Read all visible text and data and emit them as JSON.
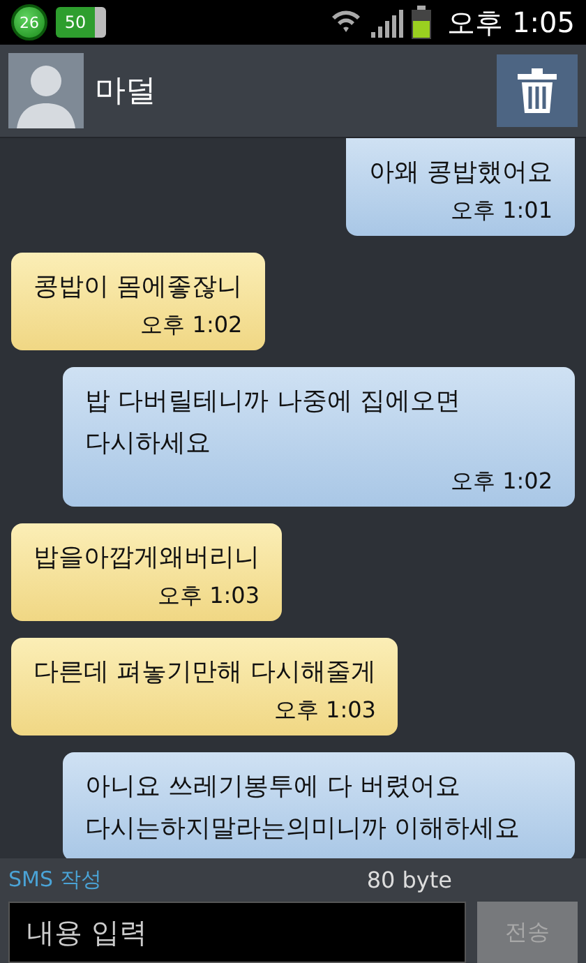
{
  "status_bar": {
    "temperature": "26",
    "battery_widget": "50",
    "time": "오후 1:05"
  },
  "header": {
    "contact_name": "마덜"
  },
  "messages": [
    {
      "kind": "outgoing",
      "text": "아왜 콩밥했어요",
      "time": "오후 1:01"
    },
    {
      "kind": "incoming",
      "text": "콩밥이 몸에좋잖니",
      "time": "오후 1:02"
    },
    {
      "kind": "outgoing",
      "text": "밥 다버릴테니까 나중에 집에오면 다시하세요",
      "time": "오후 1:02"
    },
    {
      "kind": "incoming",
      "text": "밥을아깝게왜버리니",
      "time": "오후 1:03"
    },
    {
      "kind": "incoming",
      "text": "다른데 펴놓기만해 다시해줄게",
      "time": "오후 1:03"
    },
    {
      "kind": "outgoing",
      "text": "아니요 쓰레기봉투에 다 버렸어요 다시는하지말라는의미니까 이해하세요"
    }
  ],
  "compose": {
    "mode_label": "SMS 작성",
    "byte_count": "80 byte",
    "placeholder": "내용 입력",
    "send_button": {
      "label": "전송",
      "disabled": true
    }
  }
}
